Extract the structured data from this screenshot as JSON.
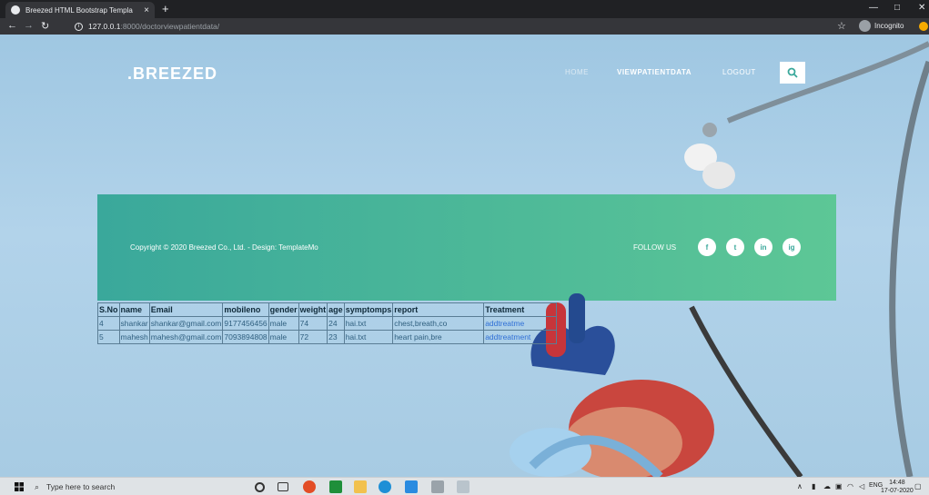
{
  "browser": {
    "tab_title": "Breezed HTML Bootstrap Templa",
    "tab_close": "×",
    "new_tab": "+",
    "url_host": "127.0.0.1",
    "url_path": ":8000/doctorviewpatientdata/",
    "incognito_label": "Incognito"
  },
  "site": {
    "brand": ".BREEZED",
    "nav": {
      "home": "HOME",
      "view_patient_data": "VIEWPATIENTDATA",
      "logout": "LOGOUT"
    },
    "footer": {
      "copyright": "Copyright © 2020 Breezed Co., Ltd. - Design: TemplateMo",
      "follow": "FOLLOW US",
      "social": [
        "f",
        "t",
        "in",
        "ig"
      ]
    }
  },
  "table": {
    "headers": [
      "S.No",
      "name",
      "Email",
      "mobileno",
      "gender",
      "weight",
      "age",
      "symptomps",
      "report",
      "Treatment"
    ],
    "rows": [
      [
        "4",
        "shankar",
        "shankar@gmail.com",
        "9177456456",
        "male",
        "74",
        "24",
        "hai.txt",
        "chest,breath,co",
        "addtreatme"
      ],
      [
        "5",
        "mahesh",
        "mahesh@gmail.com",
        "7093894808",
        "male",
        "72",
        "23",
        "hai.txt",
        "heart pain,bre",
        "addtreatment"
      ]
    ]
  },
  "taskbar": {
    "search_placeholder": "Type here to search",
    "lang": "ENG",
    "time": "14:48",
    "date": "17-07-2020"
  }
}
